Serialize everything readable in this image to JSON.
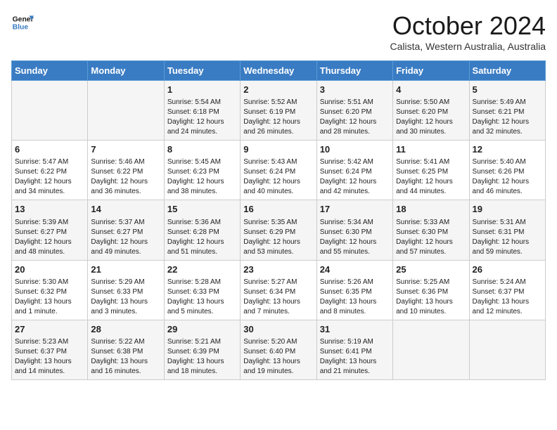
{
  "header": {
    "logo_line1": "General",
    "logo_line2": "Blue",
    "month": "October 2024",
    "location": "Calista, Western Australia, Australia"
  },
  "weekdays": [
    "Sunday",
    "Monday",
    "Tuesday",
    "Wednesday",
    "Thursday",
    "Friday",
    "Saturday"
  ],
  "weeks": [
    [
      {
        "day": "",
        "info": ""
      },
      {
        "day": "",
        "info": ""
      },
      {
        "day": "1",
        "info": "Sunrise: 5:54 AM\nSunset: 6:18 PM\nDaylight: 12 hours and 24 minutes."
      },
      {
        "day": "2",
        "info": "Sunrise: 5:52 AM\nSunset: 6:19 PM\nDaylight: 12 hours and 26 minutes."
      },
      {
        "day": "3",
        "info": "Sunrise: 5:51 AM\nSunset: 6:20 PM\nDaylight: 12 hours and 28 minutes."
      },
      {
        "day": "4",
        "info": "Sunrise: 5:50 AM\nSunset: 6:20 PM\nDaylight: 12 hours and 30 minutes."
      },
      {
        "day": "5",
        "info": "Sunrise: 5:49 AM\nSunset: 6:21 PM\nDaylight: 12 hours and 32 minutes."
      }
    ],
    [
      {
        "day": "6",
        "info": "Sunrise: 5:47 AM\nSunset: 6:22 PM\nDaylight: 12 hours and 34 minutes."
      },
      {
        "day": "7",
        "info": "Sunrise: 5:46 AM\nSunset: 6:22 PM\nDaylight: 12 hours and 36 minutes."
      },
      {
        "day": "8",
        "info": "Sunrise: 5:45 AM\nSunset: 6:23 PM\nDaylight: 12 hours and 38 minutes."
      },
      {
        "day": "9",
        "info": "Sunrise: 5:43 AM\nSunset: 6:24 PM\nDaylight: 12 hours and 40 minutes."
      },
      {
        "day": "10",
        "info": "Sunrise: 5:42 AM\nSunset: 6:24 PM\nDaylight: 12 hours and 42 minutes."
      },
      {
        "day": "11",
        "info": "Sunrise: 5:41 AM\nSunset: 6:25 PM\nDaylight: 12 hours and 44 minutes."
      },
      {
        "day": "12",
        "info": "Sunrise: 5:40 AM\nSunset: 6:26 PM\nDaylight: 12 hours and 46 minutes."
      }
    ],
    [
      {
        "day": "13",
        "info": "Sunrise: 5:39 AM\nSunset: 6:27 PM\nDaylight: 12 hours and 48 minutes."
      },
      {
        "day": "14",
        "info": "Sunrise: 5:37 AM\nSunset: 6:27 PM\nDaylight: 12 hours and 49 minutes."
      },
      {
        "day": "15",
        "info": "Sunrise: 5:36 AM\nSunset: 6:28 PM\nDaylight: 12 hours and 51 minutes."
      },
      {
        "day": "16",
        "info": "Sunrise: 5:35 AM\nSunset: 6:29 PM\nDaylight: 12 hours and 53 minutes."
      },
      {
        "day": "17",
        "info": "Sunrise: 5:34 AM\nSunset: 6:30 PM\nDaylight: 12 hours and 55 minutes."
      },
      {
        "day": "18",
        "info": "Sunrise: 5:33 AM\nSunset: 6:30 PM\nDaylight: 12 hours and 57 minutes."
      },
      {
        "day": "19",
        "info": "Sunrise: 5:31 AM\nSunset: 6:31 PM\nDaylight: 12 hours and 59 minutes."
      }
    ],
    [
      {
        "day": "20",
        "info": "Sunrise: 5:30 AM\nSunset: 6:32 PM\nDaylight: 13 hours and 1 minute."
      },
      {
        "day": "21",
        "info": "Sunrise: 5:29 AM\nSunset: 6:33 PM\nDaylight: 13 hours and 3 minutes."
      },
      {
        "day": "22",
        "info": "Sunrise: 5:28 AM\nSunset: 6:33 PM\nDaylight: 13 hours and 5 minutes."
      },
      {
        "day": "23",
        "info": "Sunrise: 5:27 AM\nSunset: 6:34 PM\nDaylight: 13 hours and 7 minutes."
      },
      {
        "day": "24",
        "info": "Sunrise: 5:26 AM\nSunset: 6:35 PM\nDaylight: 13 hours and 8 minutes."
      },
      {
        "day": "25",
        "info": "Sunrise: 5:25 AM\nSunset: 6:36 PM\nDaylight: 13 hours and 10 minutes."
      },
      {
        "day": "26",
        "info": "Sunrise: 5:24 AM\nSunset: 6:37 PM\nDaylight: 13 hours and 12 minutes."
      }
    ],
    [
      {
        "day": "27",
        "info": "Sunrise: 5:23 AM\nSunset: 6:37 PM\nDaylight: 13 hours and 14 minutes."
      },
      {
        "day": "28",
        "info": "Sunrise: 5:22 AM\nSunset: 6:38 PM\nDaylight: 13 hours and 16 minutes."
      },
      {
        "day": "29",
        "info": "Sunrise: 5:21 AM\nSunset: 6:39 PM\nDaylight: 13 hours and 18 minutes."
      },
      {
        "day": "30",
        "info": "Sunrise: 5:20 AM\nSunset: 6:40 PM\nDaylight: 13 hours and 19 minutes."
      },
      {
        "day": "31",
        "info": "Sunrise: 5:19 AM\nSunset: 6:41 PM\nDaylight: 13 hours and 21 minutes."
      },
      {
        "day": "",
        "info": ""
      },
      {
        "day": "",
        "info": ""
      }
    ]
  ]
}
